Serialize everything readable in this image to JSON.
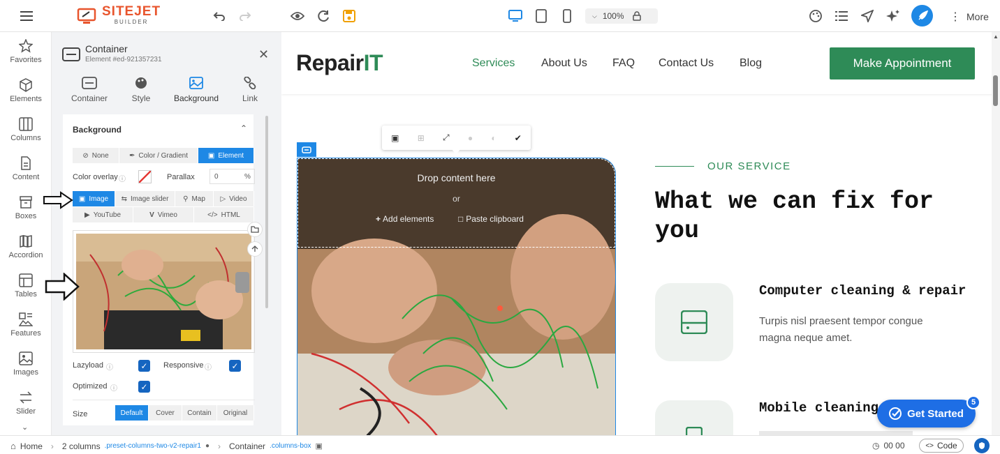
{
  "topbar": {
    "logo_text": "SITEJET",
    "logo_sub": "BUILDER",
    "zoom": "100%",
    "more_label": "More"
  },
  "leftnav": {
    "items": [
      {
        "label": "Favorites",
        "icon": "star-icon"
      },
      {
        "label": "Elements",
        "icon": "cube-icon"
      },
      {
        "label": "Columns",
        "icon": "columns-icon"
      },
      {
        "label": "Content",
        "icon": "document-icon"
      },
      {
        "label": "Boxes",
        "icon": "box-icon"
      },
      {
        "label": "Accordion",
        "icon": "accordion-icon"
      },
      {
        "label": "Tables",
        "icon": "table-icon"
      },
      {
        "label": "Features",
        "icon": "features-icon"
      },
      {
        "label": "Images",
        "icon": "image-icon"
      },
      {
        "label": "Slider",
        "icon": "slider-icon"
      }
    ]
  },
  "panel": {
    "title": "Container",
    "subtitle": "Element #ed-921357231",
    "tabs": [
      "Container",
      "Style",
      "Background",
      "Link"
    ],
    "section_title": "Background",
    "bg_modes": [
      "None",
      "Color / Gradient",
      "Element"
    ],
    "color_overlay_label": "Color overlay",
    "parallax_label": "Parallax",
    "parallax_value": "0",
    "parallax_unit": "%",
    "element_types_row1": [
      "Image",
      "Image slider",
      "Map",
      "Video"
    ],
    "element_types_row2": [
      "YouTube",
      "Vimeo",
      "HTML"
    ],
    "lazyload_label": "Lazyload",
    "responsive_label": "Responsive",
    "optimized_label": "Optimized",
    "size_label": "Size",
    "size_options": [
      "Default",
      "Cover",
      "Contain",
      "Original"
    ]
  },
  "site": {
    "brand_main": "Repair",
    "brand_accent": "IT",
    "nav": [
      "Services",
      "About Us",
      "FAQ",
      "Contact Us",
      "Blog"
    ],
    "cta": "Make Appointment",
    "drop_text": "Drop content here",
    "or_text": "or",
    "add_elements": "Add elements",
    "paste_clipboard": "Paste clipboard",
    "eyebrow": "OUR SERVICE",
    "heading": "What we can fix for you",
    "service1_title": "Computer cleaning & repair",
    "service1_text": "Turpis nisl praesent tempor congue magna neque amet.",
    "service2_title": "Mobile cleaning",
    "get_started": "Get Started",
    "badge": "5"
  },
  "statusbar": {
    "home": "Home",
    "crumb1": "2 columns",
    "crumb1_class": ".preset-columns-two-v2-repair1",
    "crumb2": "Container",
    "crumb2_class": ".columns-box",
    "time": "00 00",
    "code": "Code"
  },
  "colors": {
    "accent": "#1e88e5",
    "brand_green": "#2e8b57",
    "sitejet_orange": "#e8552d"
  }
}
